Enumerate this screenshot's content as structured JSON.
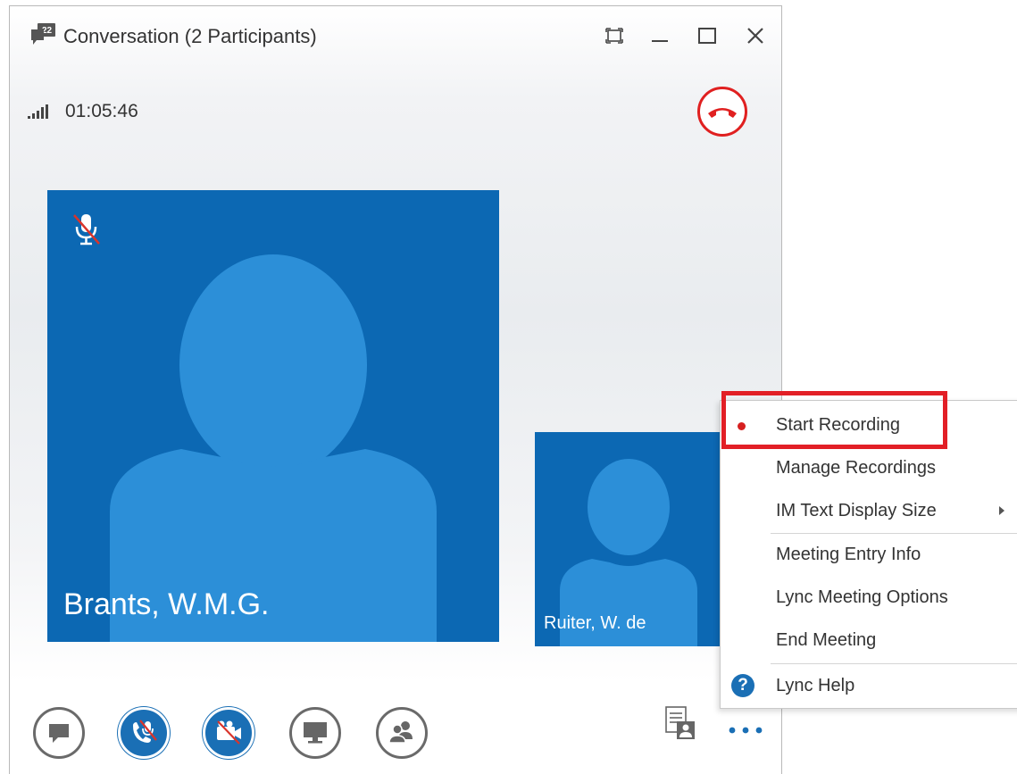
{
  "window": {
    "title": "Conversation (2 Participants)"
  },
  "call": {
    "duration": "01:05:46"
  },
  "participants": [
    {
      "name": "Brants, W.M.G.",
      "muted": true
    },
    {
      "name": "Ruiter, W. de"
    }
  ],
  "toolbar": {
    "buttons": [
      {
        "icon": "chat-icon",
        "state": "outline"
      },
      {
        "icon": "phone-muted-icon",
        "state": "filled"
      },
      {
        "icon": "video-off-icon",
        "state": "filled"
      },
      {
        "icon": "present-screen-icon",
        "state": "outline"
      },
      {
        "icon": "people-icon",
        "state": "outline"
      }
    ]
  },
  "menu": {
    "items": [
      {
        "label": "Start Recording",
        "icon": "record-dot"
      },
      {
        "label": "Manage Recordings"
      },
      {
        "label": "IM Text Display Size",
        "submenu": true
      },
      {
        "label": "Meeting Entry Info"
      },
      {
        "label": "Lync Meeting Options"
      },
      {
        "label": "End Meeting"
      },
      {
        "label": "Lync Help",
        "icon": "help-icon"
      }
    ]
  },
  "colors": {
    "accent": "#1a6fb5",
    "tile": "#0c68b3",
    "hangup": "#e02020",
    "highlight": "#e21f26"
  }
}
